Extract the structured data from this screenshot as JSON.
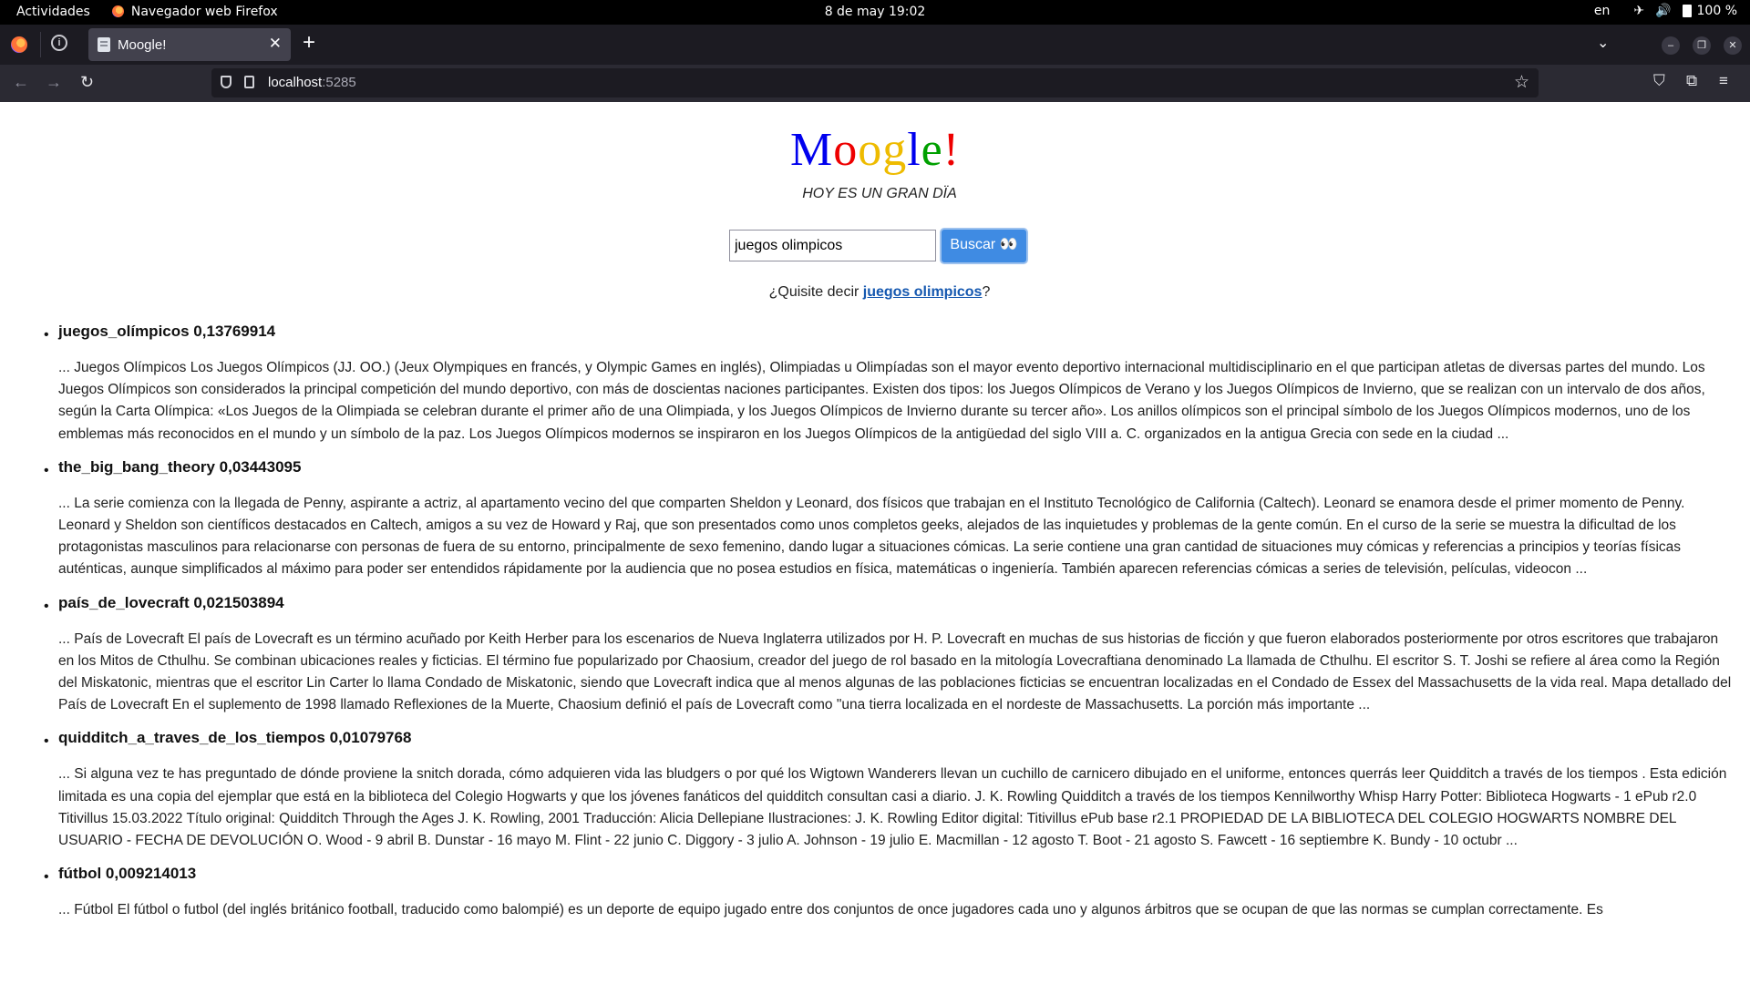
{
  "system_bar": {
    "activities": "Actividades",
    "app_name": "Navegador web Firefox",
    "datetime": "8 de may  19:02",
    "language": "en",
    "battery": "100 %"
  },
  "browser": {
    "tab_title": "Moogle!",
    "url_host": "localhost",
    "url_port": ":5285"
  },
  "page": {
    "logo_letters": [
      "M",
      "o",
      "o",
      "g",
      "l",
      "e",
      "!"
    ],
    "logo_colors": [
      "#0000ee",
      "#ee0000",
      "#eebb00",
      "#eebb00",
      "#0000ee",
      "#00a000",
      "#ee0000"
    ],
    "tagline": "HOY ES UN GRAN DÏA",
    "search_value": "juegos olimpicos",
    "search_button": "Buscar 👀",
    "suggestion_prefix": "¿Quisite decir ",
    "suggestion_link": "juegos olimpicos",
    "suggestion_suffix": "?"
  },
  "results": [
    {
      "title": "juegos_olímpicos 0,13769914",
      "snippet": "... Juegos Olímpicos  Los Juegos Olímpicos (JJ. OO.) (Jeux Olympiques en francés, y Olympic Games en inglés), Olimpiadas u Olimpíadas son el mayor evento deportivo internacional multidisciplinario en el que participan atletas de diversas partes del mundo. Los Juegos Olímpicos son considerados la principal competición del mundo deportivo, con más de doscientas naciones participantes. Existen dos tipos: los Juegos Olímpicos de Verano y los Juegos Olímpicos de Invierno, que se realizan con un intervalo de dos años, según la Carta Olímpica: «Los Juegos de la Olimpiada se celebran durante el primer año de una Olimpiada, y los Juegos Olímpicos de Invierno durante su tercer año».  Los anillos olímpicos son el principal símbolo de los Juegos Olímpicos modernos, uno de los emblemas más reconocidos en el mundo y un símbolo de la paz.  Los Juegos Olímpicos modernos se inspiraron en los Juegos Olímpicos de la antigüedad del siglo VIII a. C. organizados en la antigua Grecia con sede en la ciudad ..."
    },
    {
      "title": "the_big_bang_theory 0,03443095",
      "snippet": "... La serie comienza con la llegada de Penny, aspirante a actriz, al apartamento vecino del que comparten Sheldon y Leonard, dos físicos que trabajan en el Instituto Tecnológico de California (Caltech). Leonard se enamora desde el primer momento de Penny. Leonard y Sheldon son científicos destacados en Caltech, amigos a su vez de Howard y Raj, que son presentados como unos completos geeks, alejados de las inquietudes y problemas de la gente común. En el curso de la serie se muestra la dificultad de los protagonistas masculinos para relacionarse con personas de fuera de su entorno, principalmente de sexo femenino, dando lugar a situaciones cómicas. La serie contiene una gran cantidad de situaciones muy cómicas y referencias a principios y teorías físicas auténticas, aunque simplificados al máximo para poder ser entendidos rápidamente por la audiencia que no posea estudios en física, matemáticas o ingeniería. También aparecen referencias cómicas a series de televisión, películas, videocon ..."
    },
    {
      "title": "país_de_lovecraft 0,021503894",
      "snippet": "... País de Lovecraft  El país de Lovecraft es un término acuñado por Keith Herber para los escenarios de Nueva Inglaterra utilizados por H. P. Lovecraft en muchas de sus historias de ficción y que fueron elaborados posteriormente por otros escritores que trabajaron en los Mitos de Cthulhu. Se combinan ubicaciones reales y ficticias. El término fue popularizado por Chaosium, creador del juego de rol basado en la mitología Lovecraftiana denominado La llamada de Cthulhu. El escritor S. T. Joshi se refiere al área como la Región del Miskatonic, mientras que el escritor Lin Carter lo llama Condado de Miskatonic, siendo que Lovecraft indica que al menos algunas de las poblaciones ficticias se encuentran localizadas en el Condado de Essex del Massachusetts de la vida real. Mapa detallado del País de Lovecraft  En el suplemento de 1998 llamado Reflexiones de la Muerte, Chaosium definió el país de Lovecraft como \"una tierra localizada en el nordeste de Massachusetts. La porción más importante ..."
    },
    {
      "title": "quidditch_a_traves_de_los_tiempos 0,01079768",
      "snippet": "... Si alguna vez te has preguntado de dónde proviene la snitch dorada, cómo adquieren vida las bludgers o por qué los Wigtown Wanderers llevan un cuchillo de carnicero dibujado en el uniforme, entonces querrás leer Quidditch a través de los tiempos . Esta edición limitada es una copia del ejemplar que está en la biblioteca del Colegio Hogwarts y que los jóvenes fanáticos del quidditch consultan casi a diario. J. K. Rowling Quidditch a través de los tiempos Kennilworthy Whisp Harry Potter: Biblioteca Hogwarts - 1 ePub r2.0 Titivillus 15.03.2022 Título original: Quidditch Through the Ages J. K. Rowling, 2001 Traducción: Alicia Dellepiane Ilustraciones: J. K. Rowling Editor digital: Titivillus ePub base r2.1 PROPIEDAD DE LA BIBLIOTECA DEL COLEGIO HOGWARTS NOMBRE DEL USUARIO - FECHA DE DEVOLUCIÓN O. Wood - 9 abril B. Dunstar - 16 mayo M. Flint - 22 junio C. Diggory - 3 julio A. Johnson - 19 julio E. Macmillan - 12 agosto T. Boot - 21 agosto S. Fawcett - 16 septiembre K. Bundy - 10 octubr ..."
    },
    {
      "title": "fútbol 0,009214013",
      "snippet": "... Fútbol  El fútbol o futbol (del inglés británico football, traducido como balompié) es un deporte de equipo jugado entre dos conjuntos de once jugadores cada uno y algunos árbitros que se ocupan de que las normas se cumplan correctamente. Es"
    }
  ]
}
